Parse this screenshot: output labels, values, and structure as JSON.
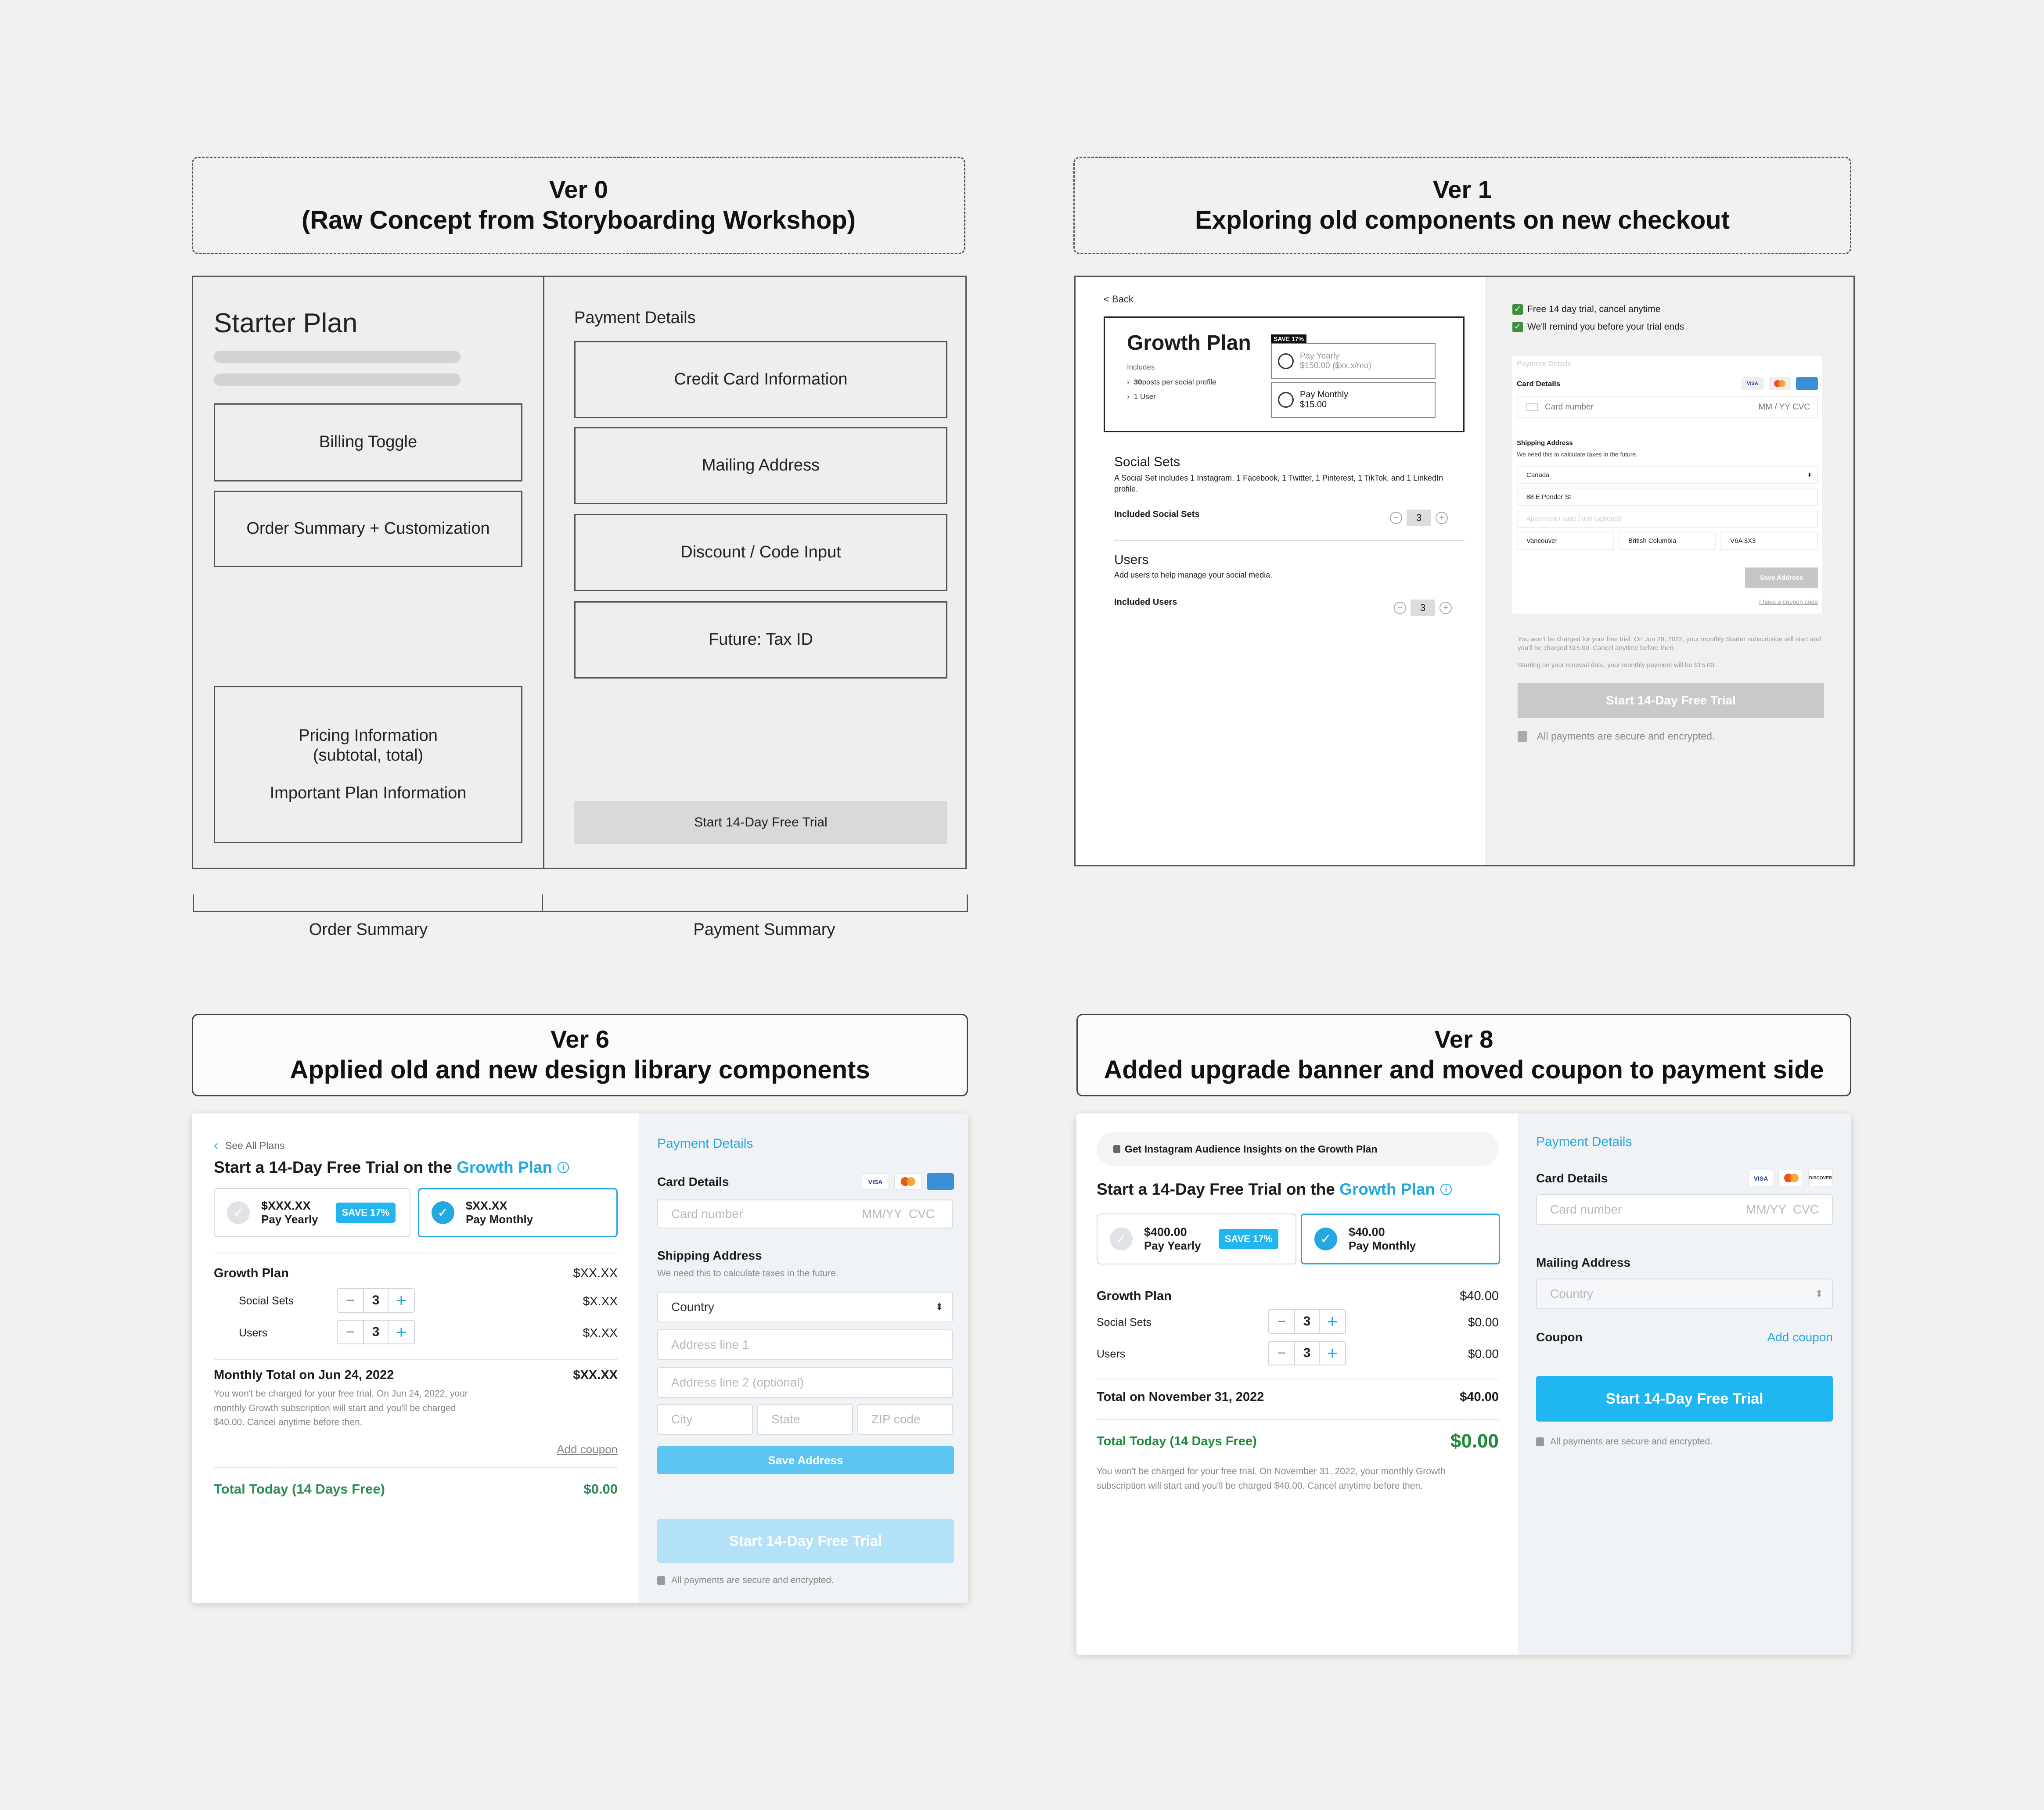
{
  "ver0": {
    "title1": "Ver 0",
    "title2": "(Raw Concept from Storyboarding Workshop)",
    "plan_title": "Starter Plan",
    "billing_toggle": "Billing Toggle",
    "order_summary": "Order Summary + Customization",
    "pricing_info_1": "Pricing Information",
    "pricing_info_2": "(subtotal, total)",
    "plan_info": "Important Plan Information",
    "payment_details": "Payment Details",
    "credit_card": "Credit Card Information",
    "mailing": "Mailing Address",
    "discount": "Discount / Code Input",
    "tax": "Future: Tax ID",
    "cta": "Start 14-Day Free Trial",
    "label_order": "Order Summary",
    "label_payment": "Payment Summary"
  },
  "ver1": {
    "title1": "Ver 1",
    "title2": "Exploring old components on new checkout",
    "back": "< Back",
    "plan": "Growth Plan",
    "includes": "Includes",
    "inc1_num": "30",
    "inc1": " posts per social profile",
    "inc2": "1 User",
    "save_badge": "SAVE 17%",
    "yearly_label": "Pay Yearly",
    "yearly_price": "$150.00 ($xx.x/mo)",
    "monthly_label": "Pay Monthly",
    "monthly_price": "$15.00",
    "social_title": "Social Sets",
    "social_desc": "A Social Set includes 1 Instagram, 1 Facebook, 1 Twitter, 1 Pinterest, 1 TikTok, and 1 LinkedIn profile.",
    "social_included": "Included Social Sets",
    "social_qty": "3",
    "users_title": "Users",
    "users_desc": "Add users to help manage your social media.",
    "users_included": "Included Users",
    "users_qty": "3",
    "check1": "Free 14 day trial, cancel anytime",
    "check2": "We'll remind you before your trial ends",
    "payment_details": "Payment Details",
    "card_details": "Card Details",
    "card_number": "Card number",
    "mm_cvc": "MM / YY  CVC",
    "shipping": "Shipping Address",
    "shipping_desc": "We need this to calculate taxes in the future.",
    "country": "Canada",
    "address": "88 E Pender St",
    "apartment": "Apartment / suite / unit (optional)",
    "city": "Vancouver",
    "province": "British Columbia",
    "postal": "V6A 3X3",
    "save_address": "Save Address",
    "coupon": "I have a coupon code",
    "note1": "You won't be charged for your free trial. On Jun 29, 2022, your monthly Starter subscription will start and you'll be charged $15.00. Cancel anytime before then.",
    "note2": "Starting on your renewal date, your monthly payment will be $15.00.",
    "cta": "Start 14-Day Free Trial",
    "secure": "All payments are secure and encrypted."
  },
  "ver6": {
    "title1": "Ver 6",
    "title2": "Applied old and new design library components",
    "see_all": "See All Plans",
    "heading_pre": "Start a 14-Day Free Trial on the ",
    "heading_plan": "Growth Plan",
    "yearly_price": "$XXX.XX",
    "yearly_label": "Pay Yearly",
    "save": "SAVE 17%",
    "monthly_price": "$XX.XX",
    "monthly_label": "Pay Monthly",
    "growth": "Growth Plan",
    "growth_price": "$XX.XX",
    "social": "Social Sets",
    "social_qty": "3",
    "social_price": "$X.XX",
    "users": "Users",
    "users_qty": "3",
    "users_price": "$X.XX",
    "monthly_total": "Monthly Total on Jun 24, 2022",
    "monthly_total_price": "$XX.XX",
    "note": "You won't be charged for your free trial.  On Jun 24, 2022, your monthly Growth subscription will start and you'll be charged $40.00. Cancel anytime before then.",
    "add_coupon": "Add coupon",
    "total_today": "Total Today (14 Days Free)",
    "total_today_price": "$0.00",
    "payment_details": "Payment Details",
    "card_details": "Card Details",
    "card_number": "Card number",
    "mm_cvc": "MM/YY  CVC",
    "shipping": "Shipping Address",
    "shipping_desc": "We need this to calculate taxes in the future.",
    "country": "Country",
    "address1": "Address line 1",
    "address2": "Address line 2 (optional)",
    "city": "City",
    "state": "State",
    "zip": "ZIP code",
    "save_address": "Save Address",
    "cta": "Start 14-Day Free Trial",
    "secure": "All payments are secure and encrypted."
  },
  "ver8": {
    "title1": "Ver 8",
    "title2": "Added upgrade banner and moved coupon to payment side",
    "banner": "Get Instagram Audience Insights on the Growth Plan",
    "heading_pre": "Start a 14-Day Free Trial on the ",
    "heading_plan": "Growth Plan",
    "yearly_price": "$400.00",
    "yearly_label": "Pay Yearly",
    "save": "SAVE 17%",
    "monthly_price": "$40.00",
    "monthly_label": "Pay Monthly",
    "growth": "Growth Plan",
    "growth_price": "$40.00",
    "social": "Social Sets",
    "social_qty": "3",
    "social_price": "$0.00",
    "users": "Users",
    "users_qty": "3",
    "users_price": "$0.00",
    "total_on": "Total on November 31, 2022",
    "total_on_price": "$40.00",
    "total_today": "Total Today (14 Days Free)",
    "total_today_price": "$0.00",
    "note": "You won't be charged for your free trial. On November 31, 2022, your monthly Growth subscription will start and you'll be charged $40.00. Cancel anytime before then.",
    "payment_details": "Payment Details",
    "card_details": "Card Details",
    "card_number": "Card number",
    "mm_cvc": "MM/YY  CVC",
    "mailing": "Mailing Address",
    "country": "Country",
    "coupon": "Coupon",
    "add_coupon": "Add coupon",
    "cta": "Start 14-Day Free Trial",
    "secure": "All payments are secure and encrypted."
  },
  "card_brands": {
    "visa": "VISA",
    "discover": "DISCOVER"
  },
  "colors": {
    "accent": "#23a8e0",
    "cta": "#1fb6f2",
    "cta_disabled": "#b3e1f7",
    "total_green": "#2e8b57",
    "check_green": "#3f8e3f"
  }
}
